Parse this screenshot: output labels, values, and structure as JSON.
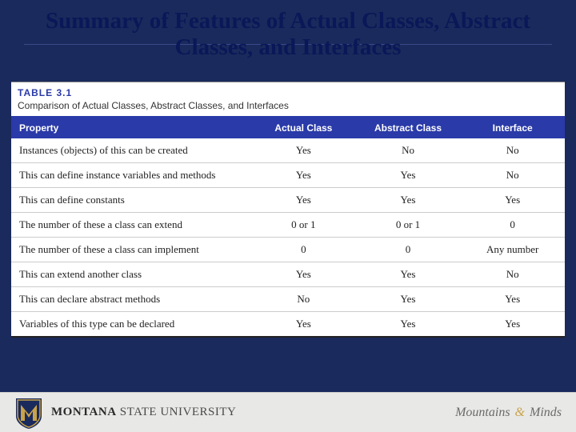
{
  "title": "Summary of Features of Actual Classes, Abstract Classes, and Interfaces",
  "table": {
    "label": "TABLE 3.1",
    "caption": "Comparison of Actual Classes, Abstract Classes, and Interfaces",
    "headers": {
      "property": "Property",
      "col1": "Actual Class",
      "col2": "Abstract Class",
      "col3": "Interface"
    },
    "rows": [
      {
        "property": "Instances (objects) of this can be created",
        "c1": "Yes",
        "c2": "No",
        "c3": "No"
      },
      {
        "property": "This can define instance variables and methods",
        "c1": "Yes",
        "c2": "Yes",
        "c3": "No"
      },
      {
        "property": "This can define constants",
        "c1": "Yes",
        "c2": "Yes",
        "c3": "Yes"
      },
      {
        "property": "The number of these a class can extend",
        "c1": "0 or 1",
        "c2": "0 or 1",
        "c3": "0"
      },
      {
        "property": "The number of these a class can implement",
        "c1": "0",
        "c2": "0",
        "c3": "Any number"
      },
      {
        "property": "This can extend another class",
        "c1": "Yes",
        "c2": "Yes",
        "c3": "No"
      },
      {
        "property": "This can declare abstract methods",
        "c1": "No",
        "c2": "Yes",
        "c3": "Yes"
      },
      {
        "property": "Variables of this type can be declared",
        "c1": "Yes",
        "c2": "Yes",
        "c3": "Yes"
      }
    ]
  },
  "footer": {
    "university_bold": "MONTANA",
    "university_rest": " STATE UNIVERSITY",
    "tagline_left": "Mountains ",
    "tagline_amp": "&",
    "tagline_right": " Minds"
  },
  "colors": {
    "slide_bg": "#1a2a5c",
    "table_header": "#2a3aa8",
    "logo_gold": "#c9a34a",
    "logo_navy": "#1a2a5c"
  }
}
